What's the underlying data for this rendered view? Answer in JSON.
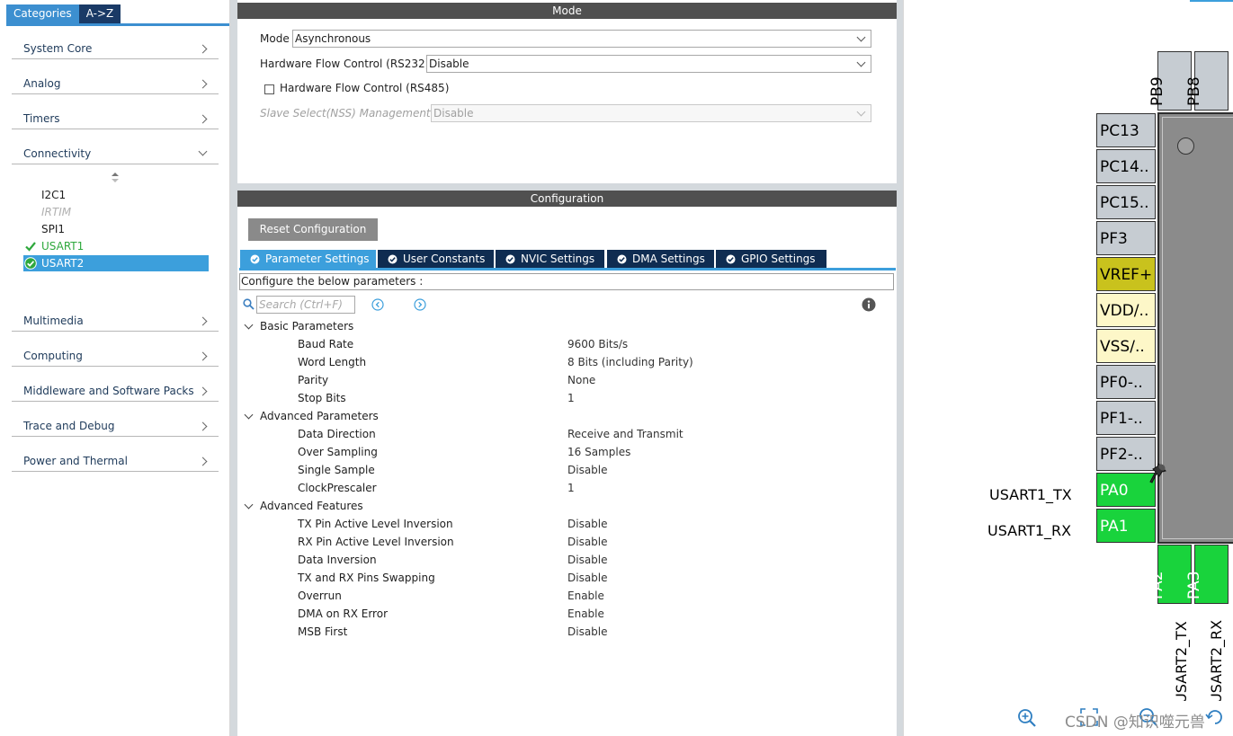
{
  "left_panel": {
    "tabs": [
      "Categories",
      "A->Z"
    ],
    "categories_top": [
      "System Core",
      "Analog",
      "Timers",
      "Connectivity"
    ],
    "connectivity_items": [
      {
        "label": "I2C1",
        "state": "normal"
      },
      {
        "label": "IRTIM",
        "state": "disabled"
      },
      {
        "label": "SPI1",
        "state": "normal"
      },
      {
        "label": "USART1",
        "state": "configured"
      },
      {
        "label": "USART2",
        "state": "selected"
      }
    ],
    "categories_bottom": [
      "Multimedia",
      "Computing",
      "Middleware and Software Packs",
      "Trace and Debug",
      "Power and Thermal"
    ]
  },
  "mode_panel": {
    "title": "Mode",
    "mode_label": "Mode",
    "mode_value": "Asynchronous",
    "hwfc232_label": "Hardware Flow Control (RS232)",
    "hwfc232_value": "Disable",
    "hwfc485_label": "Hardware Flow Control (RS485)",
    "hwfc485_checked": false,
    "nss_label": "Slave Select(NSS) Management",
    "nss_value": "Disable"
  },
  "config_panel": {
    "title": "Configuration",
    "reset_label": "Reset Configuration",
    "tabs": [
      "Parameter Settings",
      "User Constants",
      "NVIC Settings",
      "DMA Settings",
      "GPIO Settings"
    ],
    "configure_label": "Configure the below parameters :",
    "search_placeholder": "Search (Ctrl+F)",
    "groups": [
      {
        "name": "Basic Parameters",
        "params": [
          {
            "name": "Baud Rate",
            "value": "9600 Bits/s"
          },
          {
            "name": "Word Length",
            "value": "8 Bits (including Parity)"
          },
          {
            "name": "Parity",
            "value": "None"
          },
          {
            "name": "Stop Bits",
            "value": "1"
          }
        ]
      },
      {
        "name": "Advanced Parameters",
        "params": [
          {
            "name": "Data Direction",
            "value": "Receive and Transmit"
          },
          {
            "name": "Over Sampling",
            "value": "16 Samples"
          },
          {
            "name": "Single Sample",
            "value": "Disable"
          },
          {
            "name": "ClockPrescaler",
            "value": "1"
          }
        ]
      },
      {
        "name": "Advanced Features",
        "params": [
          {
            "name": "TX Pin Active Level Inversion",
            "value": "Disable"
          },
          {
            "name": "RX Pin Active Level Inversion",
            "value": "Disable"
          },
          {
            "name": "Data Inversion",
            "value": "Disable"
          },
          {
            "name": "TX and RX Pins Swapping",
            "value": "Disable"
          },
          {
            "name": "Overrun",
            "value": "Enable"
          },
          {
            "name": "DMA on RX Error",
            "value": "Enable"
          },
          {
            "name": "MSB First",
            "value": "Disable"
          }
        ]
      }
    ]
  },
  "chip_view": {
    "top_pins": [
      "PB9",
      "PB8"
    ],
    "left_pins": [
      {
        "label": "PC13",
        "color": "gray"
      },
      {
        "label": "PC14..",
        "color": "gray"
      },
      {
        "label": "PC15..",
        "color": "gray"
      },
      {
        "label": "PF3",
        "color": "gray"
      },
      {
        "label": "VREF+",
        "color": "yellow"
      },
      {
        "label": "VDD/..",
        "color": "cream"
      },
      {
        "label": "VSS/..",
        "color": "cream"
      },
      {
        "label": "PF0-..",
        "color": "gray"
      },
      {
        "label": "PF1-..",
        "color": "gray"
      },
      {
        "label": "PF2-..",
        "color": "gray"
      },
      {
        "label": "PA0",
        "color": "green"
      },
      {
        "label": "PA1",
        "color": "green"
      }
    ],
    "left_signals": [
      "USART1_TX",
      "USART1_RX"
    ],
    "bottom_pins": [
      "PA2",
      "PA3"
    ],
    "bottom_signals": [
      "USART2_TX",
      "USART2_RX"
    ],
    "colors": {
      "gray": "#c6ccd2",
      "yellow": "#c9c21d",
      "cream": "#fdf7c8",
      "green": "#19d33c"
    }
  },
  "watermark": "CSDN @知识噬元兽"
}
